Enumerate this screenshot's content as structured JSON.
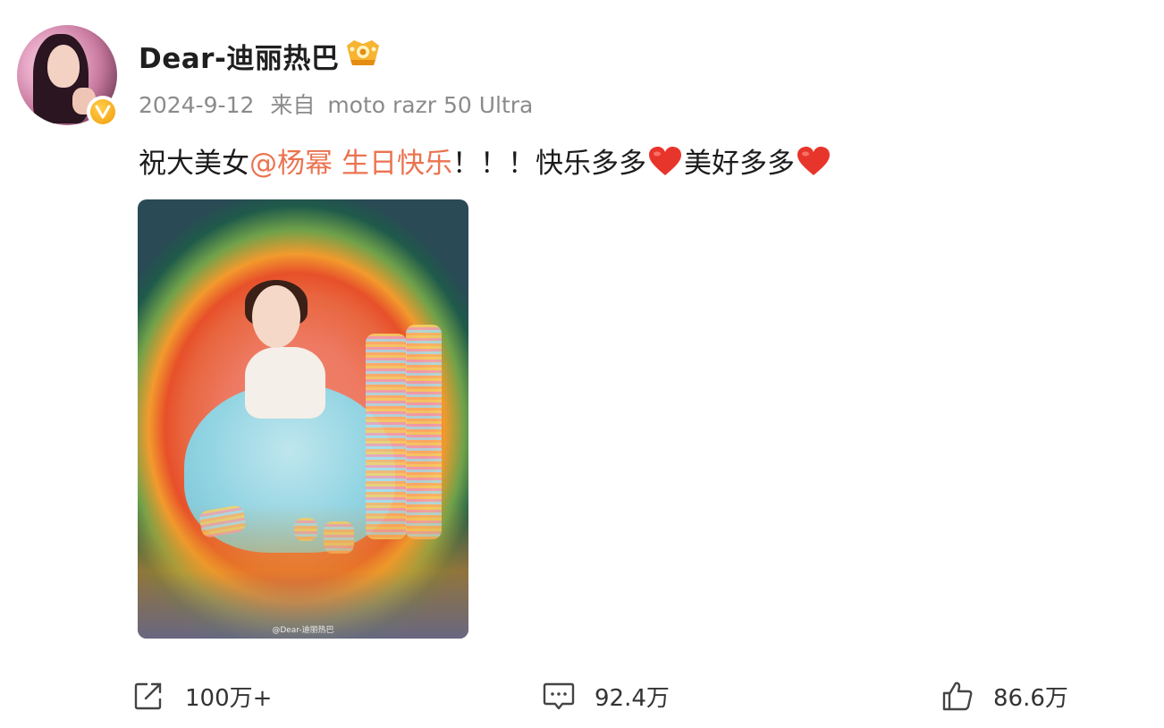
{
  "post": {
    "username": "Dear-迪丽热巴",
    "date": "2024-9-12",
    "source_prefix": "来自",
    "device": "moto razr 50 Ultra",
    "content": {
      "prefix": "祝大美女",
      "mention": "@杨幂",
      "topic": "生日快乐",
      "exclaim": "！！！",
      "text1": "快乐多多",
      "text2": "美好多多"
    },
    "photo_watermark": "@Dear-迪丽热巴"
  },
  "actions": {
    "repost_count": "100万+",
    "comment_count": "92.4万",
    "like_count": "86.6万"
  },
  "colors": {
    "mention": "#eb7350",
    "heart": "#e8352b",
    "verified": "#f29b0b"
  },
  "icons": [
    "verified-icon",
    "level-badge-icon",
    "heart-icon",
    "repost-icon",
    "comment-icon",
    "like-icon"
  ]
}
